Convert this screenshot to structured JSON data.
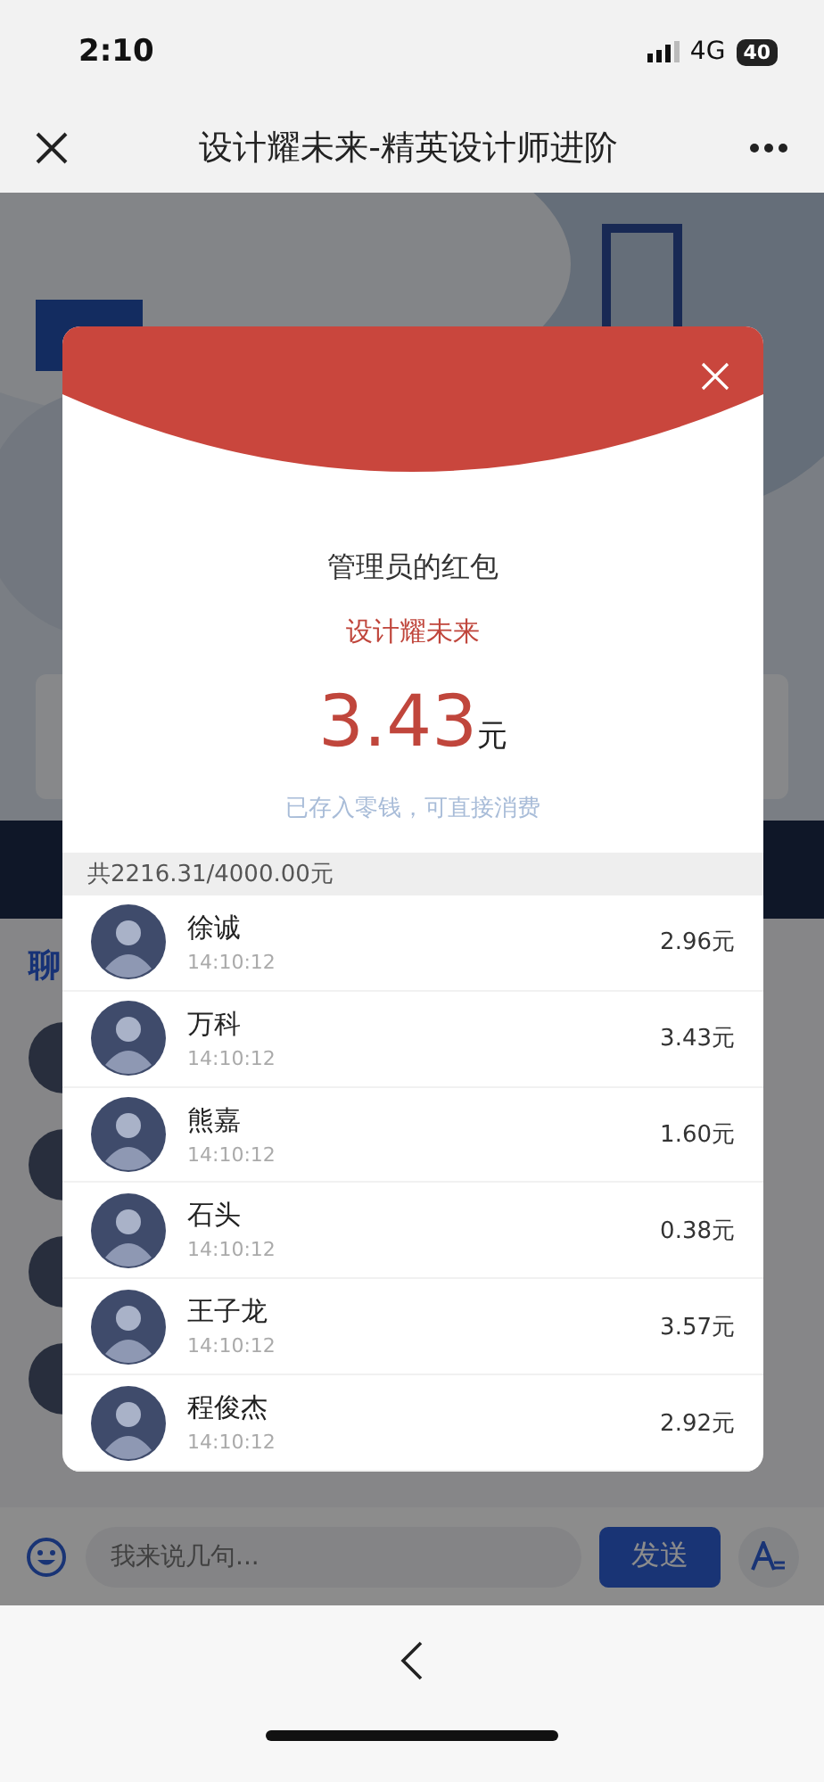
{
  "status_bar": {
    "time": "2:10",
    "network": "4G",
    "battery": "40"
  },
  "nav": {
    "title": "设计耀未来-精英设计师进阶"
  },
  "page": {
    "section_heading": "聊",
    "chat_input": {
      "placeholder": "我来说几句..."
    },
    "send_button": "发送"
  },
  "red_packet": {
    "sender": "管理员的红包",
    "greeting": "设计耀未来",
    "amount": "3.43",
    "currency": "元",
    "note": "已存入零钱，可直接消费",
    "summary": "共2216.31/4000.00元",
    "recipients": [
      {
        "name": "徐诚",
        "time": "14:10:12",
        "amount": "2.96元"
      },
      {
        "name": "万科",
        "time": "14:10:12",
        "amount": "3.43元"
      },
      {
        "name": "熊嘉",
        "time": "14:10:12",
        "amount": "1.60元"
      },
      {
        "name": "石头",
        "time": "14:10:12",
        "amount": "0.38元"
      },
      {
        "name": "王子龙",
        "time": "14:10:12",
        "amount": "3.57元"
      },
      {
        "name": "程俊杰",
        "time": "14:10:12",
        "amount": "2.92元"
      }
    ]
  }
}
